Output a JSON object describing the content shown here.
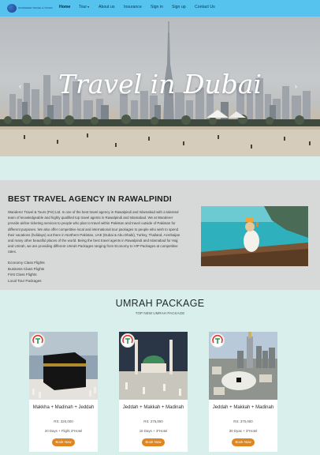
{
  "brand": {
    "logo_text": "WANDERER TRAVEL & TOURS"
  },
  "nav": {
    "home": "Home",
    "tour": "Tour",
    "about": "About us",
    "insurance": "Insurance",
    "signin": "Sign in",
    "signup": "Sign up",
    "contact": "Contact Us"
  },
  "hero": {
    "title": "Travel in Dubai",
    "prev_icon": "chevron-left-icon",
    "next_icon": "chevron-right-icon"
  },
  "agency": {
    "heading": "BEST TRAVEL AGENCY IN RAWALPINDI",
    "body": "Wanderer Travel & Tours (Pvt) Ltd. Is one of the best travel agency in Rawalpindi and Islamabad with a talented team of knowledgeable and highly qualified top travel agents in Rawalpindi and Islamabad. We at Wanderer provide airline ticketing services to people who plan to travel within Pakistan and travel outside of Pakistan for different purposes. We also offer competitive local and international tour packages to people who wish to spend their vacations (holidays) out there in Northern Pakistan, UAE (Dubai & Abu Dhabi), Turkey, Thailand, Azerbaijan and many other beautiful places of the world. Being the best travel agents in Rawalpindi and Islamabad for Hajj and Umrah, we are providing different Umrah Packages ranging from Economy to VIP Packages at competitive rates.",
    "flights": [
      "Economy Class Flights",
      "Business Class Flights",
      "First Class Flights",
      "Local Tour Packages"
    ]
  },
  "umrah": {
    "title": "UMRAH PACKAGE",
    "subtitle": "TOP NEW UMRAH PACKAGE",
    "packages": [
      {
        "name": "Makkha + Madinah + Jeddah",
        "price": "RS: 320,000",
        "meta": "20 Days + Flight 3*Hotel",
        "cta": "Book Now"
      },
      {
        "name": "Jeddah + Makkah + Madinah",
        "price": "RS: 275,000",
        "meta": "15 Days + 3*Hotel",
        "cta": "Book Now"
      },
      {
        "name": "Jeddah + Makkah + Madinah",
        "price": "RS: 370,000",
        "meta": "30 Dyas + 3*Hotel",
        "cta": "Book Now"
      }
    ]
  }
}
